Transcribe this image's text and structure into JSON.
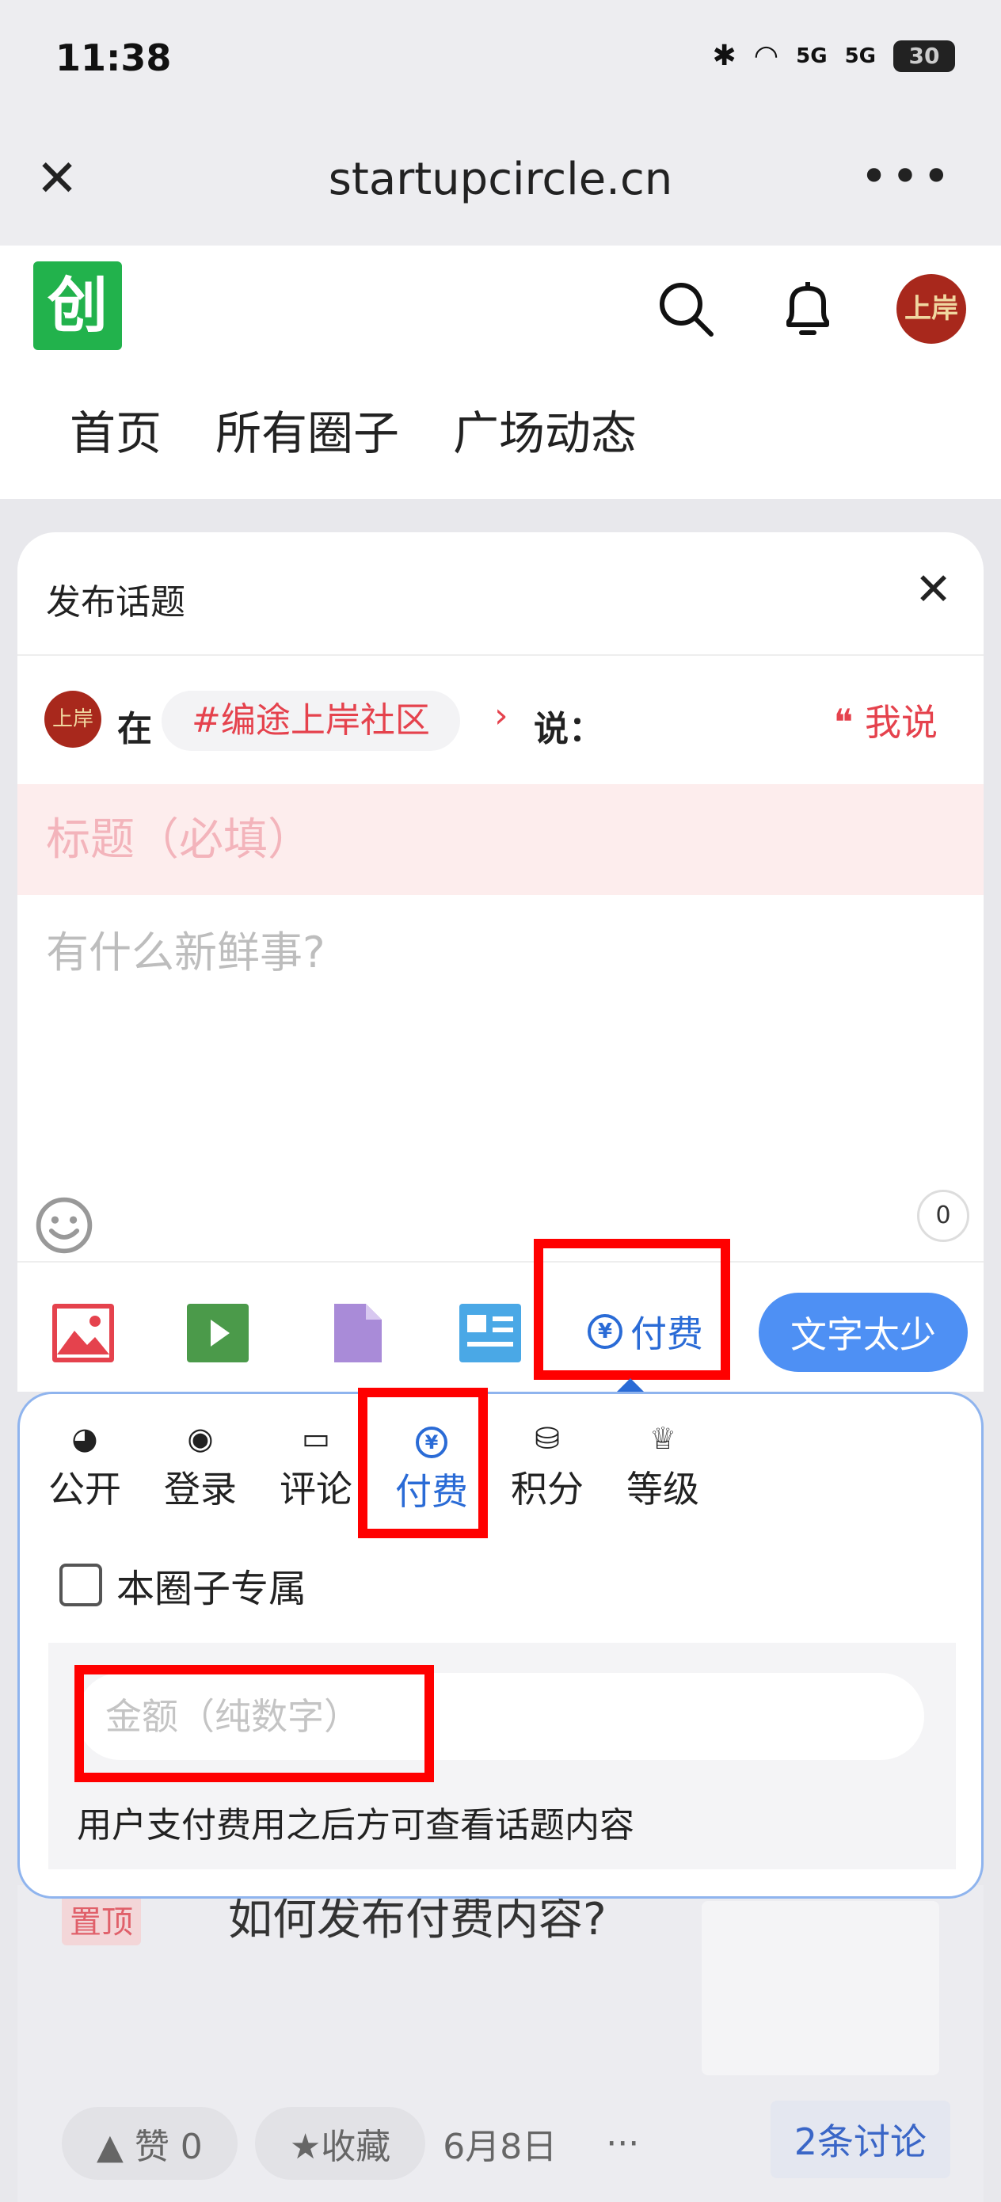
{
  "status_bar": {
    "time": "11:38",
    "battery": "30",
    "network1": "5G",
    "network2": "5G"
  },
  "browser": {
    "url": "startupcircle.cn",
    "more": "•••",
    "close": "✕"
  },
  "site": {
    "logo_text": "创",
    "avatar_text": "上岸",
    "nav": [
      "首页",
      "所有圈子",
      "广场动态"
    ]
  },
  "modal": {
    "title": "发布话题",
    "close": "✕",
    "at": "在",
    "circle": "#编途上岸社区",
    "chevron": "›",
    "say": "说：",
    "i_say": "❝ 我说",
    "title_placeholder": "标题（必填）",
    "content_placeholder": "有什么新鲜事?",
    "char_count": "0",
    "pay_label": "付费",
    "submit_label": "文字太少"
  },
  "popup": {
    "permissions": [
      {
        "label": "公开",
        "icon": "globe-icon"
      },
      {
        "label": "登录",
        "icon": "user-icon"
      },
      {
        "label": "评论",
        "icon": "comment-icon"
      },
      {
        "label": "付费",
        "icon": "yen-icon"
      },
      {
        "label": "积分",
        "icon": "coins-icon"
      },
      {
        "label": "等级",
        "icon": "crown-icon"
      }
    ],
    "active": "付费",
    "exclusive_label": "本圈子专属",
    "price_placeholder": "金额（纯数字）",
    "price_hint": "用户支付费用之后方可查看话题内容"
  },
  "background_post": {
    "pin": "置顶",
    "title": "如何发布付费内容?",
    "like": "▲ 赞 0",
    "fav": "★收藏",
    "date": "6月8日",
    "dots": "···",
    "discuss": "2条讨论"
  },
  "colors": {
    "accent": "#2a6bd6",
    "red": "#e5424d",
    "highlight": "#ff0000",
    "brand_green": "#22b24c"
  }
}
